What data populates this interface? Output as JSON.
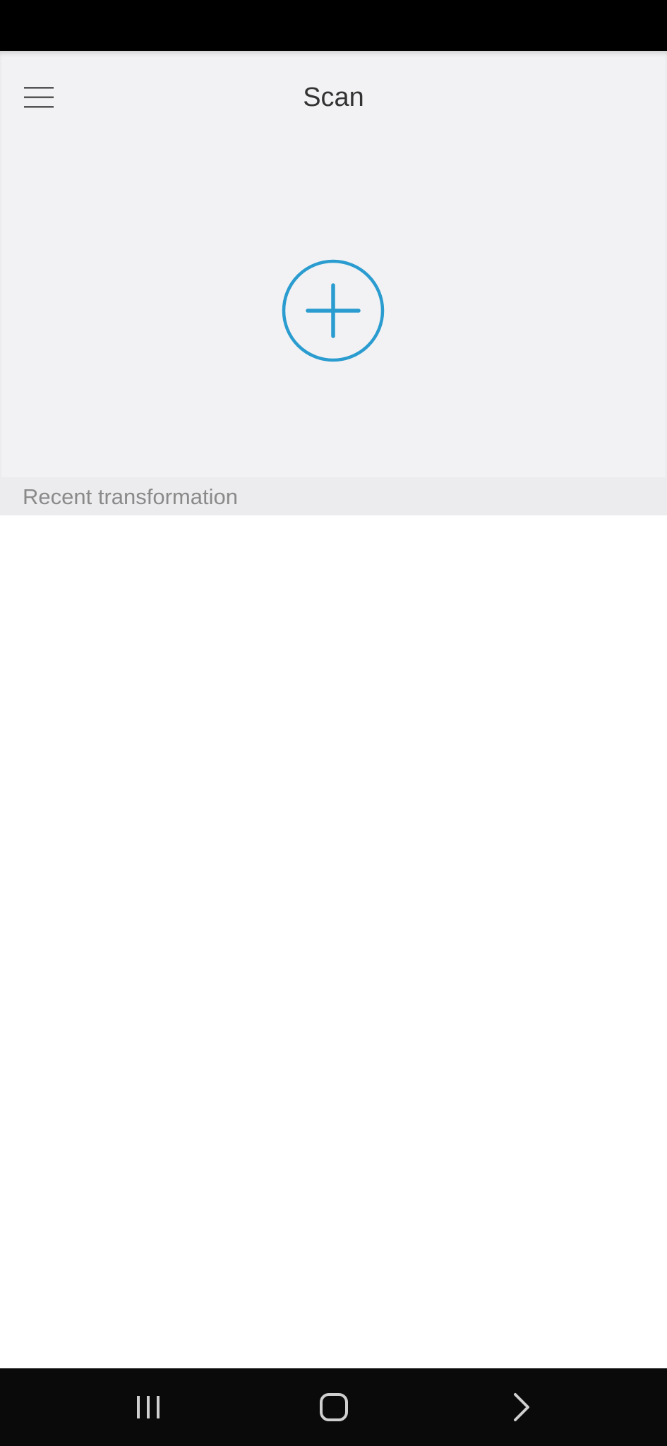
{
  "header": {
    "title": "Scan",
    "menu_icon": "hamburger-menu-icon"
  },
  "main": {
    "add_icon": "circle-plus-icon",
    "accent_color": "#2a9ccf"
  },
  "recent": {
    "label": "Recent transformation"
  },
  "navigation_bar": {
    "recent_apps_icon": "recent-apps-icon",
    "home_icon": "home-icon",
    "back_icon": "back-chevron-icon"
  }
}
